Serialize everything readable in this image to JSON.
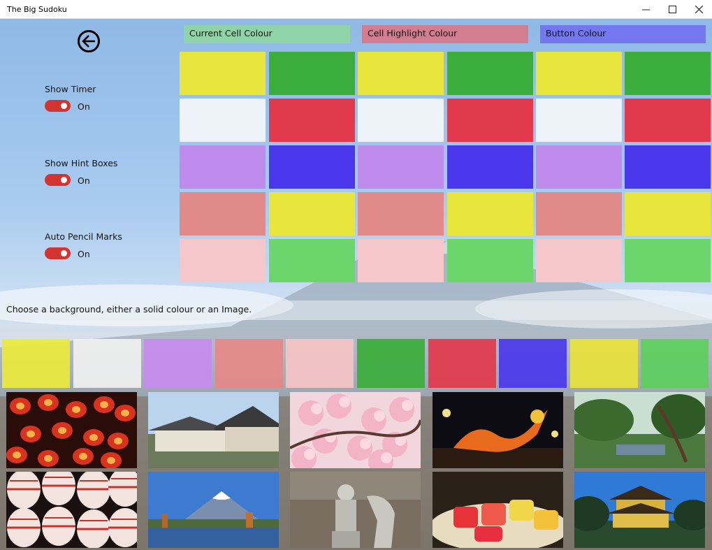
{
  "window": {
    "title": "The Big Sudoku",
    "controls": {
      "minimize": "—",
      "maximize": "☐",
      "close": "✕"
    }
  },
  "settings": {
    "show_timer": {
      "label": "Show Timer",
      "state": "On"
    },
    "show_hint_boxes": {
      "label": "Show Hint Boxes",
      "state": "On"
    },
    "auto_pencil_marks": {
      "label": "Auto Pencil Marks",
      "state": "On"
    }
  },
  "palette_headers": {
    "current_cell": {
      "label": "Current Cell Colour",
      "color": "#8fd3a9"
    },
    "cell_highlight": {
      "label": "Cell Highlight Colour",
      "color": "#d27d90"
    },
    "button": {
      "label": "Button Colour",
      "color": "#7477ee"
    }
  },
  "palette_colors": [
    [
      "#e8e63c",
      "#3aad3a",
      "#e8e63c",
      "#3aad3a",
      "#e8e63c",
      "#3aad3a"
    ],
    [
      "#edf3f8",
      "#e03a4c",
      "#edf3f8",
      "#e03a4c",
      "#edf3f8",
      "#e03a4c"
    ],
    [
      "#bf8cee",
      "#4a37ec",
      "#bf8cee",
      "#4a37ec",
      "#bf8cee",
      "#4a37ec"
    ],
    [
      "#e08a8a",
      "#e8e63c",
      "#e08a8a",
      "#e8e63c",
      "#e08a8a",
      "#e8e63c"
    ],
    [
      "#f5c6ca",
      "#6cd66c",
      "#f5c6ca",
      "#6cd66c",
      "#f5c6ca",
      "#6cd66c"
    ]
  ],
  "background": {
    "instruction": "Choose a background, either a solid colour or an Image.",
    "solid_colors": [
      "#eaea3c",
      "#f0f0f0",
      "#c58cef",
      "#e58888",
      "#f5c3c5",
      "#3aad3a",
      "#e2384c",
      "#4a37ec",
      "#e8e23a",
      "#5ccf5c"
    ],
    "images": [
      {
        "icon": "red-lanterns-image"
      },
      {
        "icon": "japanese-temple-image"
      },
      {
        "icon": "cherry-blossom-image"
      },
      {
        "icon": "golden-dragon-image"
      },
      {
        "icon": "japanese-garden-image"
      },
      {
        "icon": "paper-lanterns-image"
      },
      {
        "icon": "mount-fuji-lake-image"
      },
      {
        "icon": "samurai-statue-image"
      },
      {
        "icon": "sushi-plate-image"
      },
      {
        "icon": "golden-pavilion-image"
      }
    ]
  }
}
